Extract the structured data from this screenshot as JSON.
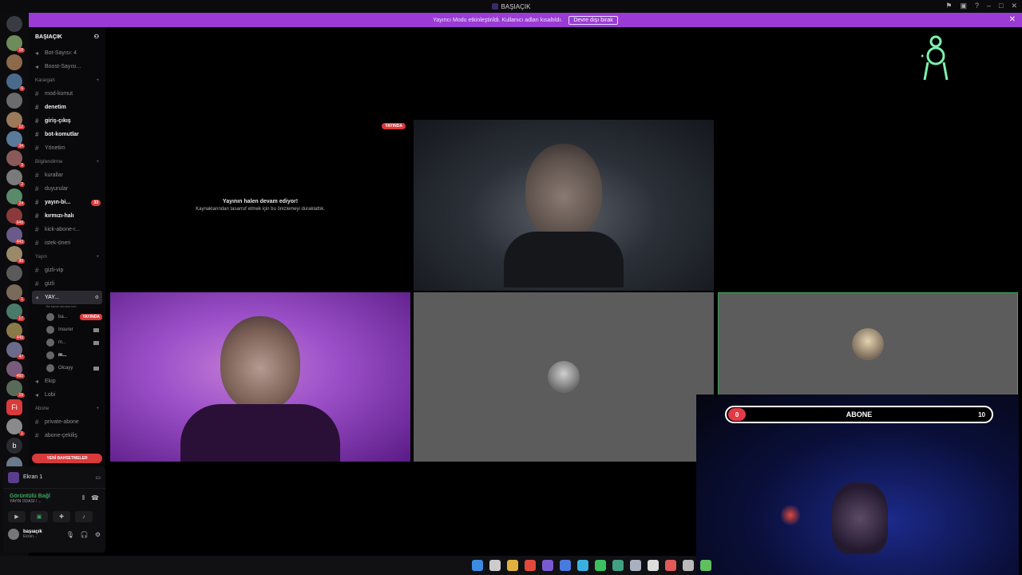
{
  "window": {
    "title": "BAŞIAÇIK"
  },
  "banner": {
    "text": "Yayıncı Modu etkinleştirildi. Kullanıcı adları kısaltıldı.",
    "button_label": "Devre dışı bırak",
    "close": "✕"
  },
  "guilds": [
    {
      "badge": "18"
    },
    {
      "badge": ""
    },
    {
      "badge": "6"
    },
    {
      "badge": ""
    },
    {
      "badge": "12"
    },
    {
      "badge": "34"
    },
    {
      "badge": "3"
    },
    {
      "badge": "2"
    },
    {
      "badge": "24"
    },
    {
      "badge": "649"
    },
    {
      "badge": "443"
    },
    {
      "badge": "98"
    },
    {
      "badge": ""
    },
    {
      "badge": "1"
    },
    {
      "badge": "17"
    },
    {
      "badge": "449"
    },
    {
      "badge": "47"
    },
    {
      "badge": "460"
    },
    {
      "badge": "19"
    },
    {
      "badge": "1"
    },
    {
      "badge": "19"
    },
    {
      "badge": ""
    },
    {
      "badge": "330"
    }
  ],
  "guild_letters": {
    "fi": "Fi",
    "b": "b"
  },
  "server": {
    "name": "BAŞIAÇIK"
  },
  "channels_top": [
    {
      "label": "Bot-Sayısı: 4"
    },
    {
      "label": "Boost-Sayısı..."
    }
  ],
  "cat_karargah": "Karargah",
  "channels_karargah": [
    {
      "label": "mod-komut"
    },
    {
      "label": "denetim"
    },
    {
      "label": "giriş-çıkış"
    },
    {
      "label": "bot-komutlar"
    },
    {
      "label": "Yönetim"
    }
  ],
  "cat_bilgilendirme": "Bilgilendirme",
  "channels_bilgi": [
    {
      "label": "kurallar"
    },
    {
      "label": "duyurular"
    },
    {
      "label": "yayın-bi...",
      "badge": "33"
    },
    {
      "label": "kırmızı-halı"
    },
    {
      "label": "kick-abone-r..."
    },
    {
      "label": "istek-öneri"
    }
  ],
  "cat_yayin": "Yayın",
  "channels_yayin": [
    {
      "label": "gizli-vip"
    },
    {
      "label": "gizli"
    }
  ],
  "active_voice": {
    "label": "YAY...",
    "status": "Bir kanal durumu bel..."
  },
  "voice_users": [
    {
      "name": "ba...",
      "live": "YAYINDA"
    },
    {
      "name": "Insurer"
    },
    {
      "name": "m..."
    },
    {
      "name": "m..."
    },
    {
      "name": "Olcayy"
    }
  ],
  "channels_voice2": [
    {
      "label": "Ekip"
    },
    {
      "label": "Lobi"
    }
  ],
  "cat_abone": "Abone",
  "channels_abone": [
    {
      "label": "private-abone"
    },
    {
      "label": "abone-çekiliş"
    }
  ],
  "new_messages_pill": "YENİ BAHSETMELER",
  "panel": {
    "screen_label": "Ekran 1",
    "conn_status": "Görüntülü Bağl",
    "conn_channel": "YAYIN ODASI / ...",
    "user_name": "başıaçık",
    "user_status": "Ekran..."
  },
  "stage": {
    "paused_title": "Yayının halen devam ediyor!",
    "paused_sub": "Kaynaklarından tasarruf etmek için bu önizlemeyi duraklattık.",
    "live_pill": "YAYINDA"
  },
  "sub_goal": {
    "current": "0",
    "label": "ABONE",
    "goal": "10",
    "progress": 0
  },
  "colors": {
    "banner": "#9b3bd6",
    "live": "#d93a3a",
    "connected": "#3ba55d",
    "sub_bar_fill": "#e23b47",
    "overlay_logo": "#7ef0b0"
  }
}
